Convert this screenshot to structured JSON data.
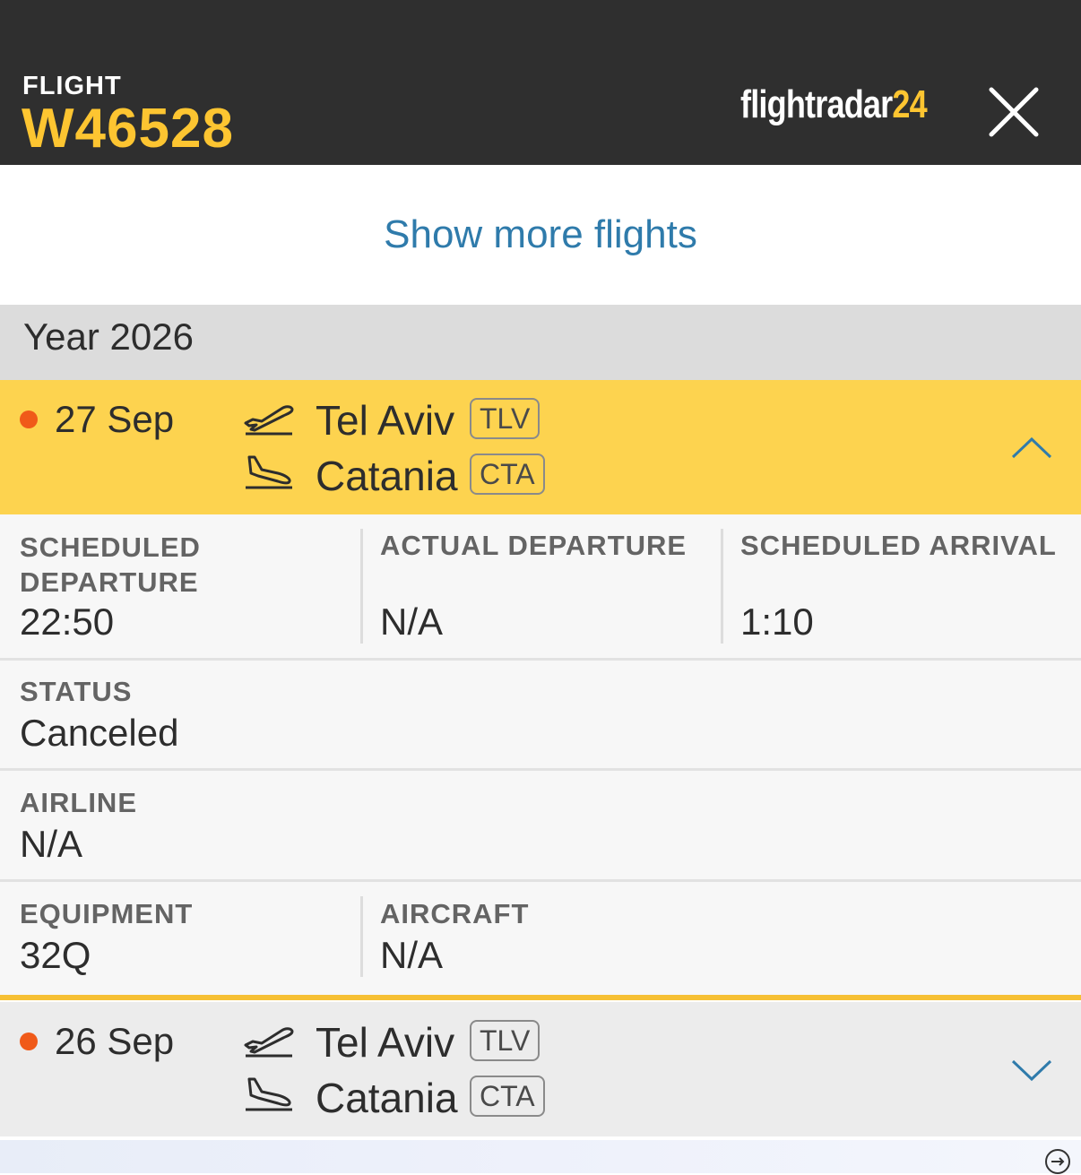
{
  "header": {
    "label": "FLIGHT",
    "flight_number": "W46528",
    "logo_main": "flightradar",
    "logo_num": "24",
    "brand_yellow": "#fdc531",
    "close_icon": "close-icon"
  },
  "show_more": "Show more flights",
  "year": "Year 2026",
  "flights": [
    {
      "date": "27 Sep",
      "from_city": "Tel Aviv",
      "from_code": "TLV",
      "to_city": "Catania",
      "to_code": "CTA",
      "expanded": true
    },
    {
      "date": "26 Sep",
      "from_city": "Tel Aviv",
      "from_code": "TLV",
      "to_city": "Catania",
      "to_code": "CTA",
      "expanded": false
    }
  ],
  "details": {
    "scheduled_departure_label_1": "SCHEDULED",
    "scheduled_departure_label_2": "DEPARTURE",
    "scheduled_departure": "22:50",
    "actual_departure_label": "ACTUAL DEPARTURE",
    "actual_departure": "N/A",
    "scheduled_arrival_label": "SCHEDULED ARRIVAL",
    "scheduled_arrival": "1:10",
    "status_label": "STATUS",
    "status": "Canceled",
    "airline_label": "AIRLINE",
    "airline": "N/A",
    "equipment_label": "EQUIPMENT",
    "equipment": "32Q",
    "aircraft_label": "AIRCRAFT",
    "aircraft": "N/A"
  },
  "colors": {
    "status_dot": "#f05a19",
    "expanded_row": "#fdd34f",
    "link_blue": "#2f7bab"
  }
}
